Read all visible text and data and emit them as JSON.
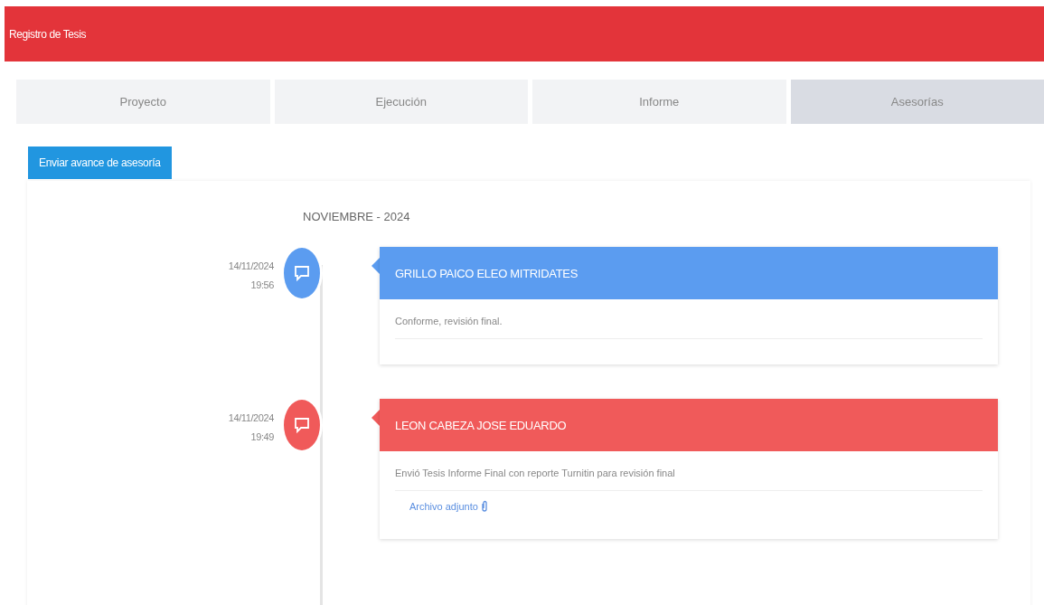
{
  "header": {
    "title": "Registro de Tesis"
  },
  "tabs": [
    {
      "label": "Proyecto",
      "selected": false
    },
    {
      "label": "Ejecución",
      "selected": false
    },
    {
      "label": "Informe",
      "selected": false
    },
    {
      "label": "Asesorías",
      "selected": true
    }
  ],
  "action_button": "Enviar avance de asesoría",
  "timeline": {
    "month": "NOVIEMBRE - 2024",
    "entries": [
      {
        "date": "14/11/2024",
        "time": "19:56",
        "author": "GRILLO PAICO ELEO MITRIDATES",
        "color": "#5b9cf0",
        "message": "Conforme, revisión final."
      },
      {
        "date": "14/11/2024",
        "time": "19:49",
        "author": "LEON CABEZA JOSE EDUARDO",
        "color": "#f05a5a",
        "message": "Envió Tesis Informe Final con reporte Turnitin para revisión final",
        "attachment": "Archivo adjunto"
      }
    ]
  }
}
